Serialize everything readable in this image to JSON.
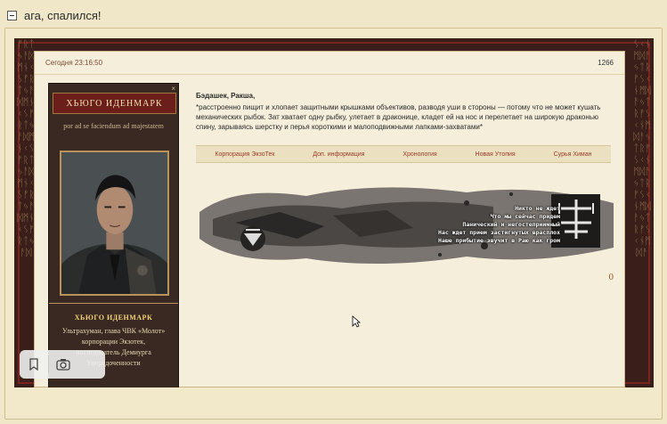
{
  "spoiler": {
    "title": "ага, спалился!"
  },
  "post": {
    "date": "Сегодня 23:16:50",
    "number": "1266",
    "reply_count": "0"
  },
  "author": {
    "name": "ХЬЮГО ИДЕНМАРК",
    "motto": "por ad se faciendum ad majestatem",
    "name_bottom": "ХЬЮГО ИДЕНМАРК",
    "description": "Ультрахуман, глава ЧВК «Молот» корпорации Экзотек, последователь Демиурга Упорядоченности"
  },
  "message": {
    "to": "Бэдашек, Ракша,",
    "text": "*расстроенно пищит и хлопает защитными крышками объективов, разводя уши в стороны — потому что не может кушать механических рыбок. Зат хватает одну рыбку, улетает в драконице, кладет ей на нос и перелетает на широкую драконью спину, зарываясь шерстку и перья короткими и малоподвижными лапками-захватами*"
  },
  "tabs": [
    {
      "label": "Корпорация ЭкзоТек"
    },
    {
      "label": "Доп. информация"
    },
    {
      "label": "Хронология"
    },
    {
      "label": "Новая Утопия"
    },
    {
      "label": "Сурья Химан"
    }
  ],
  "banner": {
    "lines": [
      "Никто не ждет",
      "Что мы сейчас придем",
      "Панический и негостеприимный",
      "Нас ждет прием застигнутых врасплох",
      "Наше прибытие звучит в Раю как гром"
    ]
  },
  "icons": {
    "toggle": "collapse-icon",
    "bookmark": "bookmark-icon",
    "camera": "camera-icon"
  },
  "colors": {
    "accent": "#9b3a26",
    "frame": "#3a1e1a",
    "paper": "#f4eedb"
  }
}
